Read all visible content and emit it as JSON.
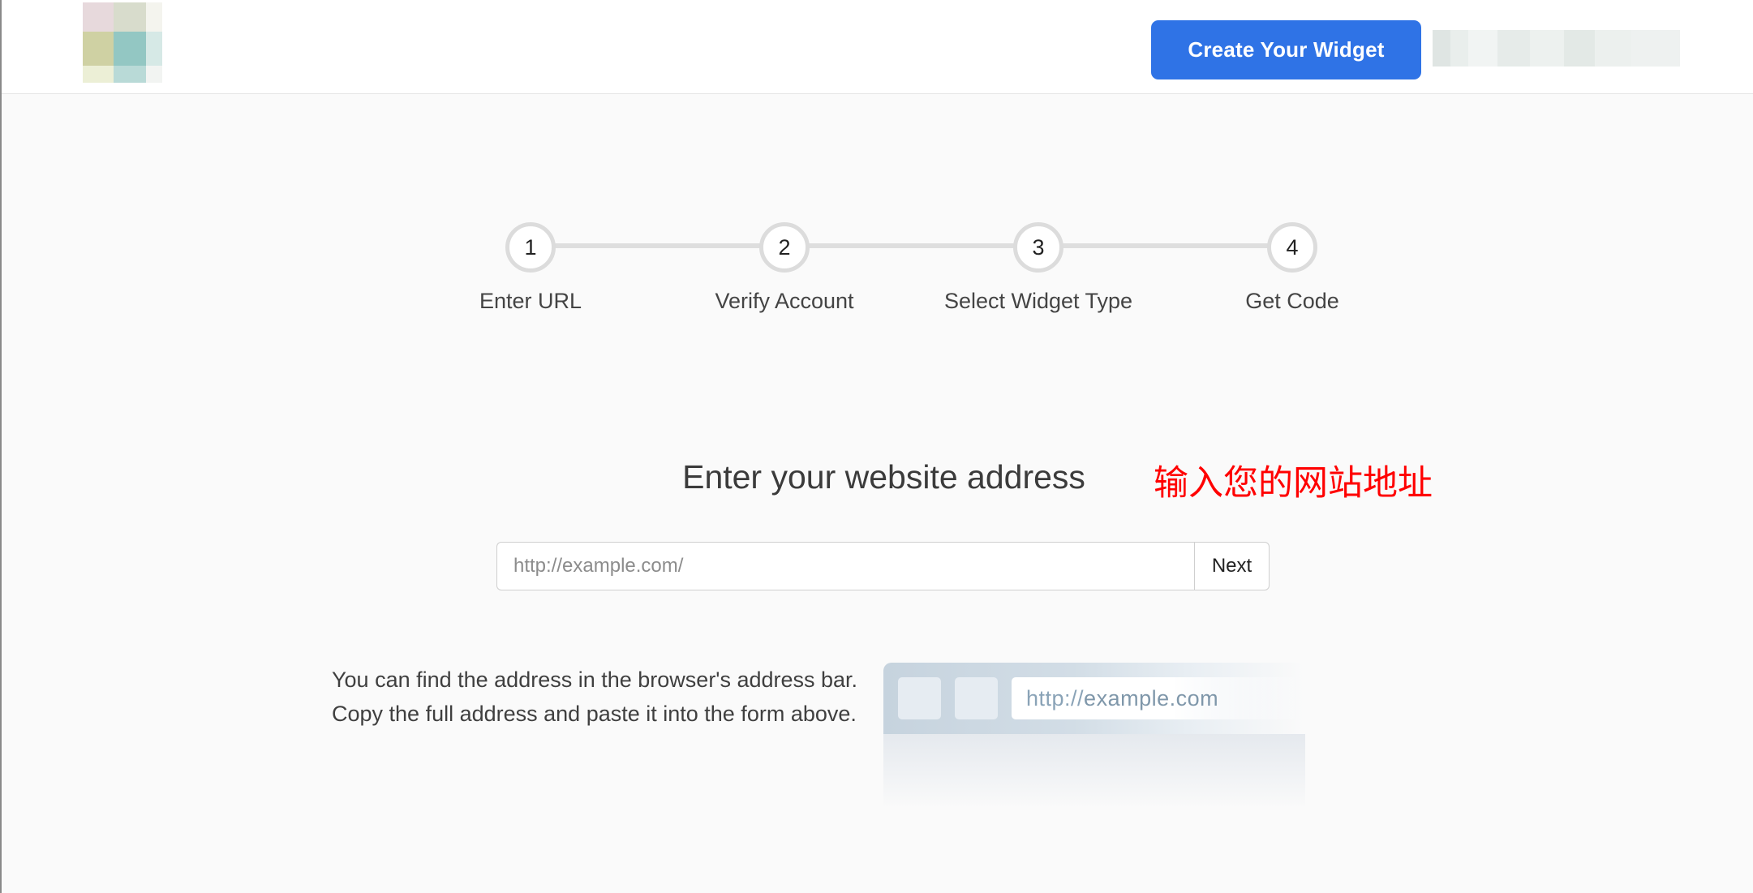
{
  "header": {
    "create_button_label": "Create Your Widget"
  },
  "stepper": {
    "steps": [
      {
        "number": "1",
        "label": "Enter URL"
      },
      {
        "number": "2",
        "label": "Verify Account"
      },
      {
        "number": "3",
        "label": "Select Widget Type"
      },
      {
        "number": "4",
        "label": "Get Code"
      }
    ]
  },
  "main": {
    "title": "Enter your website address",
    "annotation": "输入您的网站地址",
    "url_input": {
      "value": "",
      "placeholder": "http://example.com/"
    },
    "next_label": "Next",
    "help_text": "You can find the address in the browser's address bar. Copy the full address and paste it into the form above.",
    "illustration": {
      "url_prefix": "http://",
      "url_rest": "example.com"
    }
  },
  "colors": {
    "primary": "#2f73e6",
    "annotation": "#ff0000",
    "background": "#fafafa"
  }
}
